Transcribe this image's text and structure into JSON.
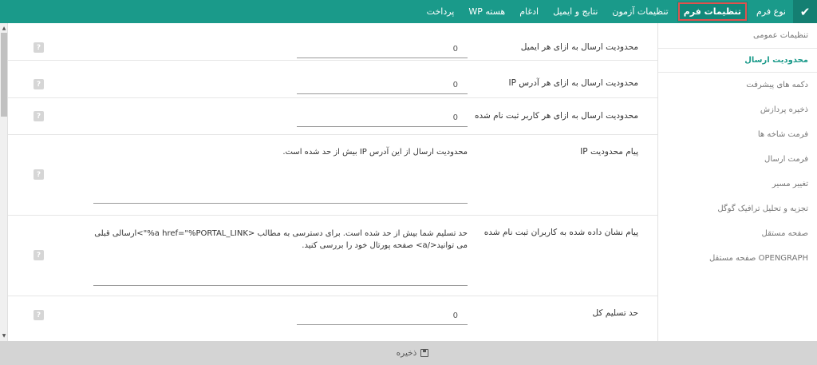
{
  "nav": {
    "check_icon": "✔",
    "tabs": [
      {
        "label": "نوع فرم"
      },
      {
        "label": "تنظیمات فرم"
      },
      {
        "label": "تنظیمات آزمون"
      },
      {
        "label": "نتایج و ایمیل"
      },
      {
        "label": "ادغام"
      },
      {
        "label": "هسته WP"
      },
      {
        "label": "پرداخت"
      }
    ]
  },
  "sidebar": {
    "items": [
      {
        "label": "تنظیمات عمومی"
      },
      {
        "label": "محدودیت ارسال"
      },
      {
        "label": "دکمه های پیشرفت"
      },
      {
        "label": "ذخیره پردازش"
      },
      {
        "label": "فرمت شاخه ها"
      },
      {
        "label": "فرمت ارسال"
      },
      {
        "label": "تغییر مسیر"
      },
      {
        "label": "تجزیه و تحلیل ترافیک گوگل"
      },
      {
        "label": "صفحه مستقل"
      },
      {
        "label": "OPENGRAPH صفحه مستقل"
      }
    ]
  },
  "settings": [
    {
      "label": "محدودیت ارسال به ازای هر ایمیل",
      "value": "0"
    },
    {
      "label": "محدودیت ارسال به ازای هر آدرس IP",
      "value": "0"
    },
    {
      "label": "محدودیت ارسال به ازای هر کاربر ثبت نام شده",
      "value": "0"
    },
    {
      "label": "پیام محدودیت IP",
      "value": "محدودیت ارسال از این آدرس IP بیش از حد شده است."
    },
    {
      "label": "پیام نشان داده شده به کاربران ثبت نام شده",
      "value": "حد تسلیم شما بیش از حد شده است. برای دسترسی به مطالب <a href=\"%PORTAL_LINK%\">ارسالی قبلی می توانید</a> صفحه پورتال خود را بررسی کنید."
    },
    {
      "label": "حد تسلیم کل",
      "value": "0"
    }
  ],
  "help_glyph": "?",
  "footer": {
    "save_label": "ذخیره"
  }
}
